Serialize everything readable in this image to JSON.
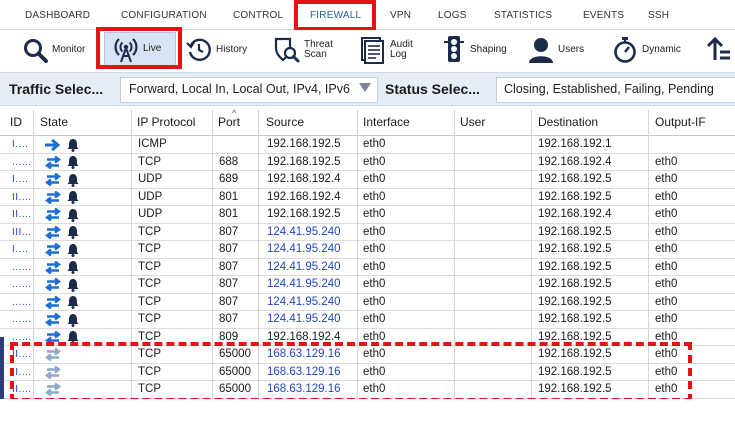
{
  "nav": {
    "tabs": [
      "DASHBOARD",
      "CONFIGURATION",
      "CONTROL",
      "FIREWALL",
      "VPN",
      "LOGS",
      "STATISTICS",
      "EVENTS",
      "SSH"
    ],
    "active": "FIREWALL"
  },
  "toolbar": {
    "monitor": "Monitor",
    "live": "Live",
    "history": "History",
    "threat_scan": "Threat Scan",
    "audit_log": "Audit Log",
    "shaping": "Shaping",
    "users": "Users",
    "dynamic": "Dynamic"
  },
  "selectors": {
    "traffic_title": "Traffic Selec...",
    "traffic_value": "Forward, Local In, Local Out, IPv4, IPv6",
    "status_title": "Status Selec...",
    "status_value": "Closing, Established, Failing, Pending"
  },
  "table": {
    "headers": {
      "id": "ID",
      "state": "State",
      "protocol": "IP Protocol",
      "port": "Port",
      "source": "Source",
      "interface": "Interface",
      "user": "User",
      "destination": "Destination",
      "output_if": "Output-IF"
    },
    "rows": [
      {
        "id": "I....",
        "state": "out",
        "protocol": "ICMP",
        "port": "",
        "source": "192.168.192.5",
        "src_link": false,
        "iface": "eth0",
        "user": "",
        "dest": "192.168.192.1",
        "out": ""
      },
      {
        "id": "......",
        "state": "both",
        "protocol": "TCP",
        "port": "688",
        "source": "192.168.192.5",
        "src_link": false,
        "iface": "eth0",
        "user": "",
        "dest": "192.168.192.4",
        "out": "eth0"
      },
      {
        "id": "I....",
        "state": "both",
        "protocol": "UDP",
        "port": "689",
        "source": "192.168.192.4",
        "src_link": false,
        "iface": "eth0",
        "user": "",
        "dest": "192.168.192.5",
        "out": "eth0"
      },
      {
        "id": "II....",
        "state": "both",
        "protocol": "UDP",
        "port": "801",
        "source": "192.168.192.4",
        "src_link": false,
        "iface": "eth0",
        "user": "",
        "dest": "192.168.192.5",
        "out": "eth0"
      },
      {
        "id": "II....",
        "state": "both",
        "protocol": "UDP",
        "port": "801",
        "source": "192.168.192.5",
        "src_link": false,
        "iface": "eth0",
        "user": "",
        "dest": "192.168.192.4",
        "out": "eth0"
      },
      {
        "id": "III...",
        "state": "both",
        "protocol": "TCP",
        "port": "807",
        "source": "124.41.95.240",
        "src_link": true,
        "iface": "eth0",
        "user": "",
        "dest": "192.168.192.5",
        "out": "eth0"
      },
      {
        "id": "I....",
        "state": "both",
        "protocol": "TCP",
        "port": "807",
        "source": "124.41.95.240",
        "src_link": true,
        "iface": "eth0",
        "user": "",
        "dest": "192.168.192.5",
        "out": "eth0"
      },
      {
        "id": "......",
        "state": "both",
        "protocol": "TCP",
        "port": "807",
        "source": "124.41.95.240",
        "src_link": true,
        "iface": "eth0",
        "user": "",
        "dest": "192.168.192.5",
        "out": "eth0"
      },
      {
        "id": "......",
        "state": "both",
        "protocol": "TCP",
        "port": "807",
        "source": "124.41.95.240",
        "src_link": true,
        "iface": "eth0",
        "user": "",
        "dest": "192.168.192.5",
        "out": "eth0"
      },
      {
        "id": "......",
        "state": "both",
        "protocol": "TCP",
        "port": "807",
        "source": "124.41.95.240",
        "src_link": true,
        "iface": "eth0",
        "user": "",
        "dest": "192.168.192.5",
        "out": "eth0"
      },
      {
        "id": "......",
        "state": "both",
        "protocol": "TCP",
        "port": "807",
        "source": "124.41.95.240",
        "src_link": true,
        "iface": "eth0",
        "user": "",
        "dest": "192.168.192.5",
        "out": "eth0"
      },
      {
        "id": "......",
        "state": "both",
        "protocol": "TCP",
        "port": "809",
        "source": "192.168.192.4",
        "src_link": false,
        "iface": "eth0",
        "user": "",
        "dest": "192.168.192.5",
        "out": "eth0"
      },
      {
        "id": "II....",
        "state": "faded",
        "protocol": "TCP",
        "port": "65000",
        "source": "168.63.129.16",
        "src_link": true,
        "iface": "eth0",
        "user": "",
        "dest": "192.168.192.5",
        "out": "eth0"
      },
      {
        "id": "II....",
        "state": "faded",
        "protocol": "TCP",
        "port": "65000",
        "source": "168.63.129.16",
        "src_link": true,
        "iface": "eth0",
        "user": "",
        "dest": "192.168.192.5",
        "out": "eth0"
      },
      {
        "id": "II....",
        "state": "faded",
        "protocol": "TCP",
        "port": "65000",
        "source": "168.63.129.16",
        "src_link": true,
        "iface": "eth0",
        "user": "",
        "dest": "192.168.192.5",
        "out": "eth0"
      }
    ]
  },
  "colors": {
    "highlight": "#e41414",
    "link": "#1f47c4",
    "arrow": "#1e6fd1",
    "arrow_faded": "#8fa9c9",
    "selector_bar": "#e6edf6"
  }
}
